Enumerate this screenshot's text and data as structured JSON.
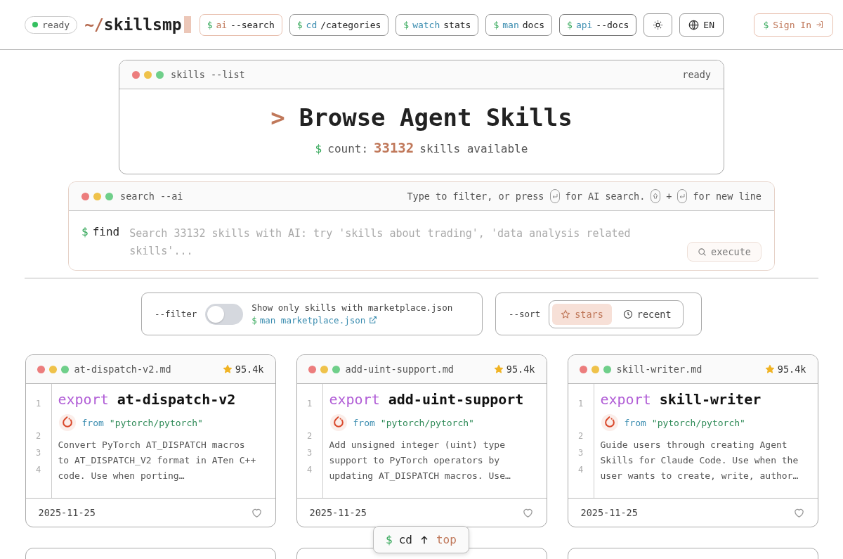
{
  "header": {
    "status": {
      "label": "ready",
      "on": true
    },
    "logo": {
      "prefix": "~/",
      "name": "skillsmp"
    },
    "nav": [
      {
        "kind": "accent",
        "prompt": "$",
        "command": "ai",
        "arg": "--search"
      },
      {
        "kind": "plain",
        "prompt": "$",
        "command": "cd",
        "arg": "/categories"
      },
      {
        "kind": "plain",
        "prompt": "$",
        "command": "watch",
        "arg": "stats"
      },
      {
        "kind": "plain",
        "prompt": "$",
        "command": "man",
        "arg": "docs"
      },
      {
        "kind": "strong",
        "prompt": "$",
        "command": "api",
        "arg": "--docs"
      }
    ],
    "language": "EN",
    "sign_in": {
      "prompt": "$",
      "label": "Sign In"
    }
  },
  "hero": {
    "window_title": "skills --list",
    "status": "ready",
    "prompt": ">",
    "title": "Browse Agent Skills",
    "count_prompt": "$",
    "count_label": "count:",
    "count": "33132",
    "count_suffix": "skills available"
  },
  "search": {
    "window_title": "search --ai",
    "hint": [
      {
        "kind": "text",
        "text": "Type to filter, or press"
      },
      {
        "kind": "enter-key"
      },
      {
        "kind": "text",
        "text": "for AI search."
      },
      {
        "kind": "shift-key"
      },
      {
        "kind": "text",
        "text": "+"
      },
      {
        "kind": "enter-key"
      },
      {
        "kind": "text",
        "text": "for new line"
      }
    ],
    "prompt": "$",
    "command": "find",
    "placeholder": "Search 33132 skills with AI: try 'skills about trading', 'data analysis related skills'...",
    "button": "execute"
  },
  "filter": {
    "label": "--filter",
    "on": false,
    "text": "Show only skills with marketplace.json",
    "link_prompt": "$",
    "link": "man marketplace.json"
  },
  "sort": {
    "label": "--sort",
    "options": [
      {
        "kind": "stars",
        "label": "stars",
        "selected": true
      },
      {
        "kind": "recent",
        "label": "recent",
        "selected": false
      }
    ]
  },
  "cards": [
    {
      "file": "at-dispatch-v2.md",
      "stars": "95.4k",
      "line_numbers": [
        "1",
        "2",
        "3",
        "4"
      ],
      "keyword": "export",
      "name": "at-dispatch-v2",
      "from": "from",
      "repo": "\"pytorch/pytorch\"",
      "description": "Convert PyTorch AT_DISPATCH macros to AT_DISPATCH_V2 format in ATen C++ code. Use when porting…",
      "date": "2025-11-25"
    },
    {
      "file": "add-uint-support.md",
      "stars": "95.4k",
      "line_numbers": [
        "1",
        "2",
        "3",
        "4"
      ],
      "keyword": "export",
      "name": "add-uint-support",
      "from": "from",
      "repo": "\"pytorch/pytorch\"",
      "description": "Add unsigned integer (uint) type support to PyTorch operators by updating AT_DISPATCH macros. Use…",
      "date": "2025-11-25"
    },
    {
      "file": "skill-writer.md",
      "stars": "95.4k",
      "line_numbers": [
        "1",
        "2",
        "3",
        "4"
      ],
      "keyword": "export",
      "name": "skill-writer",
      "from": "from",
      "repo": "\"pytorch/pytorch\"",
      "description": "Guide users through creating Agent Skills for Claude Code. Use when the user wants to create, write, author…",
      "date": "2025-11-25"
    }
  ],
  "back_to_top": {
    "prompt": "$",
    "command": "cd",
    "target": "top"
  }
}
